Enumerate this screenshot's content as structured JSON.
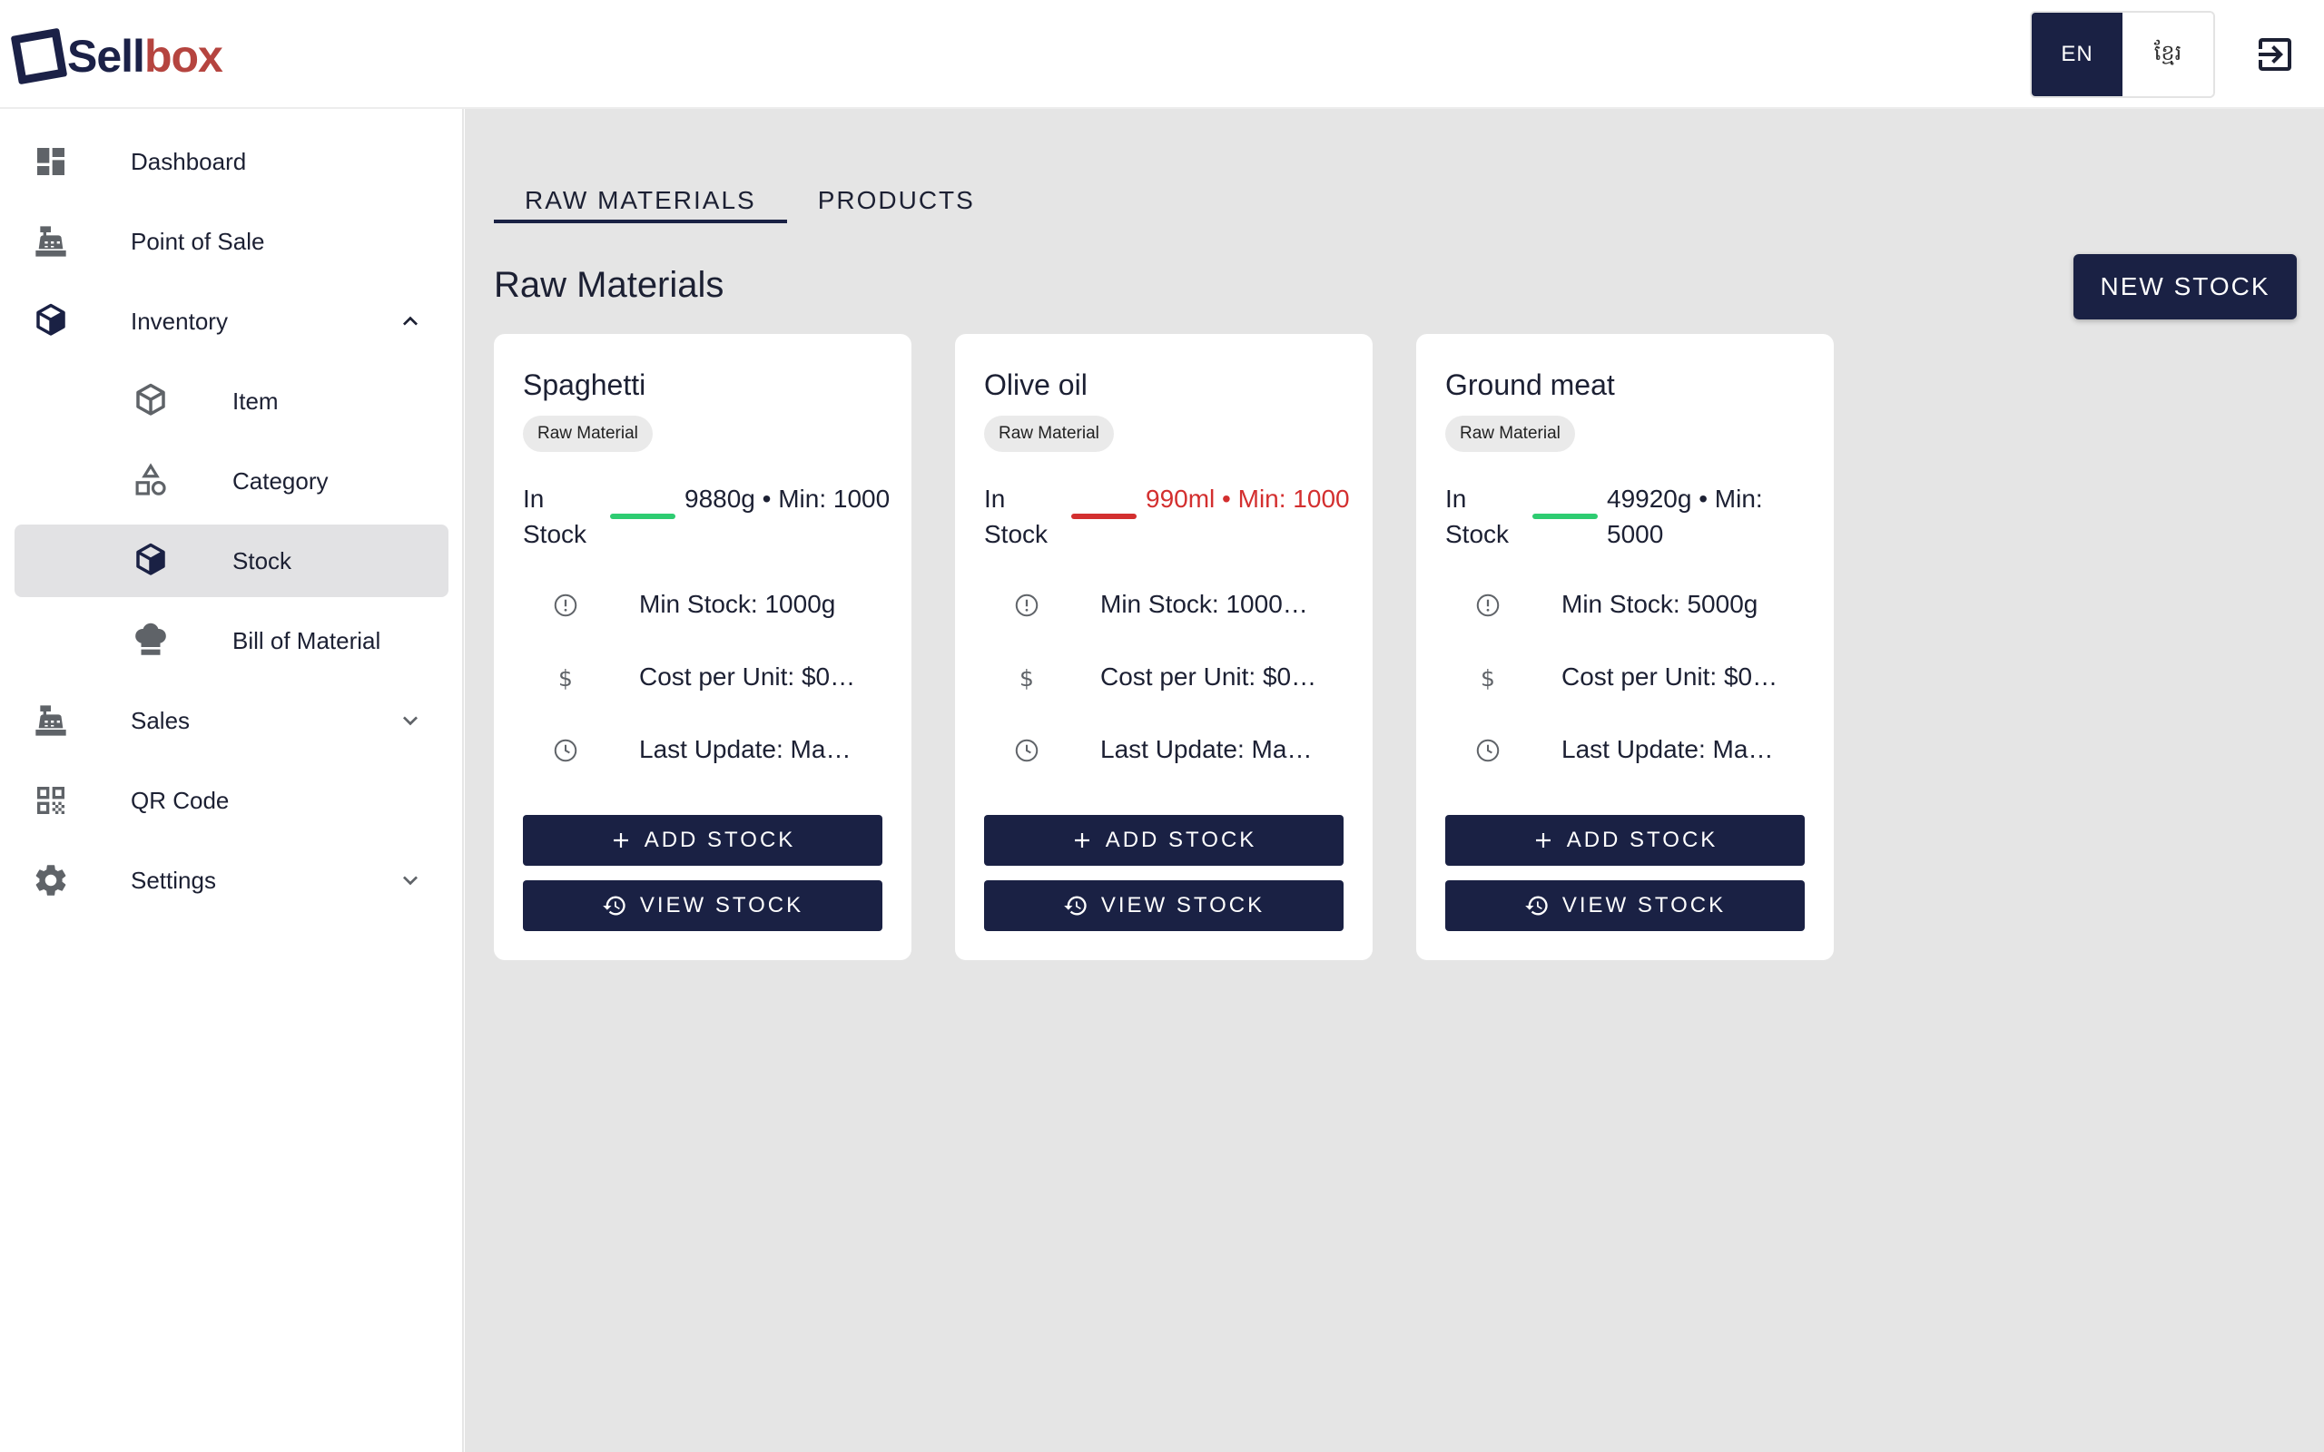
{
  "app": {
    "logo_part1": "Sell",
    "logo_part2": "box"
  },
  "header": {
    "lang_active": "EN",
    "lang_other": "ខ្មែរ"
  },
  "sidebar": {
    "items": [
      {
        "label": "Dashboard",
        "icon": "dashboard-icon"
      },
      {
        "label": "Point of Sale",
        "icon": "cash-register-icon"
      },
      {
        "label": "Inventory",
        "icon": "cube-icon",
        "expanded": true
      },
      {
        "label": "Item",
        "icon": "box-icon"
      },
      {
        "label": "Category",
        "icon": "shapes-icon"
      },
      {
        "label": "Stock",
        "icon": "cube-icon",
        "active": true
      },
      {
        "label": "Bill of Material",
        "icon": "chef-hat-icon"
      },
      {
        "label": "Sales",
        "icon": "cash-register-icon"
      },
      {
        "label": "QR Code",
        "icon": "qr-code-icon"
      },
      {
        "label": "Settings",
        "icon": "gear-icon"
      }
    ]
  },
  "main": {
    "tabs": [
      {
        "label": "RAW MATERIALS",
        "active": true
      },
      {
        "label": "PRODUCTS",
        "active": false
      }
    ],
    "title": "Raw Materials",
    "new_stock_label": "NEW STOCK"
  },
  "cards": [
    {
      "name": "Spaghetti",
      "chip": "Raw Material",
      "status": "In Stock",
      "qty": "9880g • Min: 1000",
      "min_stock": "Min Stock: 1000g",
      "cost": "Cost per Unit: $0…",
      "updated": "Last Update: Ma…",
      "level_ok": true
    },
    {
      "name": "Olive oil",
      "chip": "Raw Material",
      "status": "In Stock",
      "qty": "990ml • Min: 1000",
      "min_stock": "Min Stock: 1000…",
      "cost": "Cost per Unit: $0…",
      "updated": "Last Update: Ma…",
      "level_ok": false
    },
    {
      "name": "Ground meat",
      "chip": "Raw Material",
      "status": "In Stock",
      "qty": "49920g • Min: 5000",
      "min_stock": "Min Stock: 5000g",
      "cost": "Cost per Unit: $0…",
      "updated": "Last Update: Ma…",
      "level_ok": true
    }
  ],
  "card_buttons": {
    "add": "ADD STOCK",
    "view": "VIEW STOCK"
  },
  "colors": {
    "primary": "#1a2144",
    "ok": "#2ecc71",
    "low": "#d32f2f",
    "logo_accent": "#b5443f"
  }
}
